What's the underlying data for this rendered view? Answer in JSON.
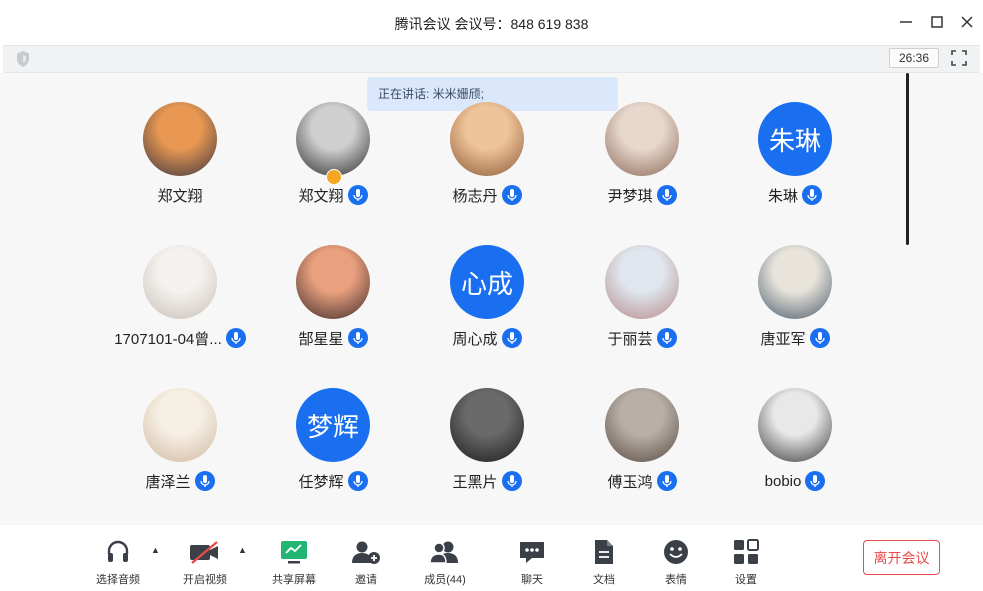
{
  "window": {
    "title": "腾讯会议  会议号：848 619 838",
    "timer": "26:36"
  },
  "speaking": "正在讲话: 米米姗颀;",
  "participants": [
    {
      "name": "郑文翔",
      "mic": false,
      "avatar_text": "",
      "avatar_colors": [
        "#e89852",
        "#3a3440"
      ],
      "host": false
    },
    {
      "name": "郑文翔",
      "mic": true,
      "avatar_text": "",
      "avatar_colors": [
        "#cfcfcf",
        "#2a2a2a"
      ],
      "host": true
    },
    {
      "name": "杨志丹",
      "mic": true,
      "avatar_text": "",
      "avatar_colors": [
        "#f0c49a",
        "#8a5a36"
      ],
      "host": false
    },
    {
      "name": "尹梦琪",
      "mic": true,
      "avatar_text": "",
      "avatar_colors": [
        "#e8d8cc",
        "#8a6a5a"
      ],
      "host": false
    },
    {
      "name": "朱琳",
      "mic": true,
      "avatar_text": "朱琳",
      "avatar_colors": [
        "#1a6ff0",
        "#1a6ff0"
      ],
      "host": false
    },
    {
      "name": "1707101-04曾...",
      "mic": true,
      "avatar_text": "",
      "avatar_colors": [
        "#f4f1ee",
        "#c9c0b8"
      ],
      "host": false
    },
    {
      "name": "郜星星",
      "mic": true,
      "avatar_text": "",
      "avatar_colors": [
        "#e9a07e",
        "#3d2a2a"
      ],
      "host": false
    },
    {
      "name": "周心成",
      "mic": true,
      "avatar_text": "心成",
      "avatar_colors": [
        "#1a6ff0",
        "#1a6ff0"
      ],
      "host": false
    },
    {
      "name": "于丽芸",
      "mic": true,
      "avatar_text": "",
      "avatar_colors": [
        "#dfe6ee",
        "#b58a8a"
      ],
      "host": false
    },
    {
      "name": "唐亚军",
      "mic": true,
      "avatar_text": "",
      "avatar_colors": [
        "#e8e4dc",
        "#4a5a6a"
      ],
      "host": false
    },
    {
      "name": "唐泽兰",
      "mic": true,
      "avatar_text": "",
      "avatar_colors": [
        "#f6efe4",
        "#d0b8a0"
      ],
      "host": false
    },
    {
      "name": "任梦辉",
      "mic": true,
      "avatar_text": "梦辉",
      "avatar_colors": [
        "#1a6ff0",
        "#1a6ff0"
      ],
      "host": false
    },
    {
      "name": "王黑片",
      "mic": true,
      "avatar_text": "",
      "avatar_colors": [
        "#6a6a6a",
        "#1a1a1a"
      ],
      "host": false
    },
    {
      "name": "傅玉鸿",
      "mic": true,
      "avatar_text": "",
      "avatar_colors": [
        "#b8b0a8",
        "#5a4a40"
      ],
      "host": false
    },
    {
      "name": "bobio",
      "mic": true,
      "avatar_text": "",
      "avatar_colors": [
        "#e8e8e8",
        "#3a3a3a"
      ],
      "host": false
    }
  ],
  "toolbar": {
    "audio": "选择音频",
    "video": "开启视频",
    "share": "共享屏幕",
    "invite": "邀请",
    "members": "成员(44)",
    "chat": "聊天",
    "docs": "文档",
    "emoji": "表情",
    "settings": "设置",
    "leave": "离开会议"
  },
  "colors": {
    "accent": "#1a6ff0",
    "danger": "#e84b4b",
    "share_green": "#22b573"
  }
}
